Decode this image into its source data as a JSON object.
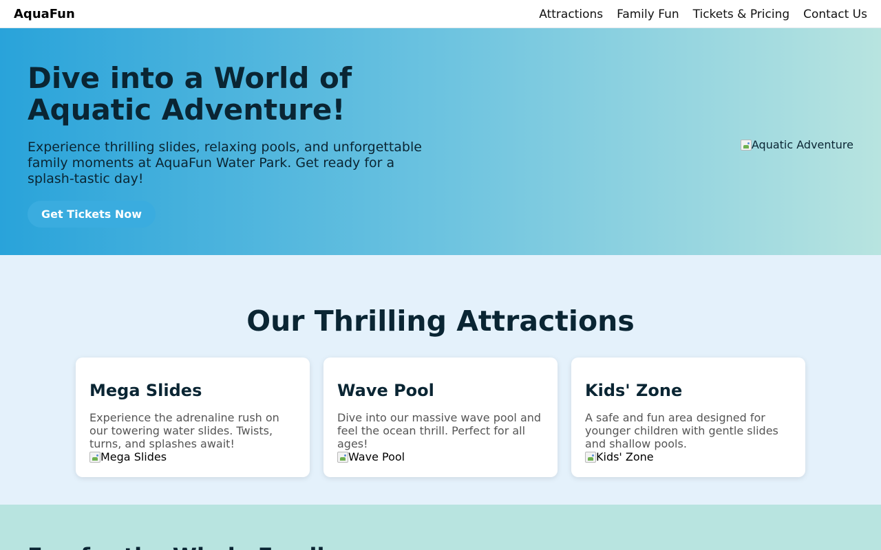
{
  "nav": {
    "brand": "AquaFun",
    "links": [
      "Attractions",
      "Family Fun",
      "Tickets & Pricing",
      "Contact Us"
    ]
  },
  "hero": {
    "title": "Dive into a World of Aquatic Adventure!",
    "text": "Experience thrilling slides, relaxing pools, and unforgettable family moments at AquaFun Water Park. Get ready for a splash-tastic day!",
    "button": "Get Tickets Now",
    "image_alt": "Aquatic Adventure"
  },
  "attractions": {
    "title": "Our Thrilling Attractions",
    "cards": [
      {
        "title": "Mega Slides",
        "text": "Experience the adrenaline rush on our towering water slides. Twists, turns, and splashes await!",
        "image_alt": "Mega Slides"
      },
      {
        "title": "Wave Pool",
        "text": "Dive into our massive wave pool and feel the ocean thrill. Perfect for all ages!",
        "image_alt": "Wave Pool"
      },
      {
        "title": "Kids' Zone",
        "text": "A safe and fun area designed for younger children with gentle slides and shallow pools.",
        "image_alt": "Kids' Zone"
      }
    ]
  },
  "family": {
    "title": "Fun for the Whole Family"
  },
  "colors": {
    "hero_gradient_start": "#29a3da",
    "hero_gradient_end": "#b8e4e0",
    "button": "#3aacdf",
    "attractions_bg": "#e4f1fb",
    "family_bg": "#b8e4e0"
  },
  "icons": {
    "broken_image": "broken-image-icon"
  }
}
